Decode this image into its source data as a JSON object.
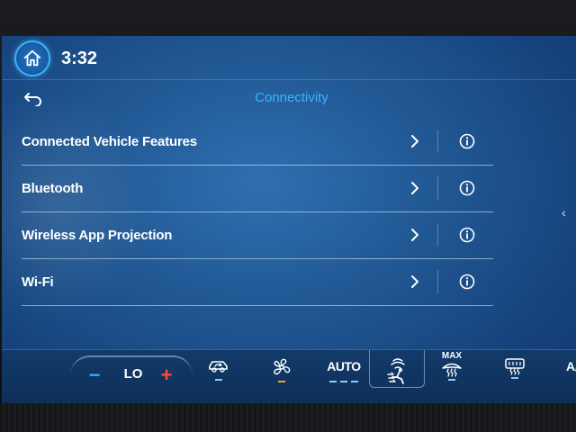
{
  "status_bar": {
    "time": "3:32",
    "home_icon": "home-icon"
  },
  "header": {
    "back_icon": "back-arrow-icon",
    "title": "Connectivity"
  },
  "settings_list": {
    "items": [
      {
        "label": "Connected Vehicle Features",
        "chevron_icon": "chevron-right-icon",
        "info_icon": "info-icon"
      },
      {
        "label": "Bluetooth",
        "chevron_icon": "chevron-right-icon",
        "info_icon": "info-icon"
      },
      {
        "label": "Wireless App Projection",
        "chevron_icon": "chevron-right-icon",
        "info_icon": "info-icon"
      },
      {
        "label": "Wi-Fi",
        "chevron_icon": "chevron-right-icon",
        "info_icon": "info-icon"
      }
    ]
  },
  "side_panel_tab": {
    "glyph": "‹"
  },
  "climate": {
    "temp_minus": "−",
    "temperature": "LO",
    "temp_plus": "+",
    "recirculation_icon": "recirculate-icon",
    "fan_icon": "fan-icon",
    "auto_label": "AUTO",
    "airflow_icon": "airflow-mode-icon",
    "max_defrost_label": "MAX",
    "max_defrost_icon": "max-defrost-icon",
    "rear_defrost_icon": "rear-defrost-icon",
    "ac_label": "A/C"
  },
  "colors": {
    "accent": "#3ab4ff",
    "screen_background": "#1f5590",
    "temp_minus": "#39a8ff",
    "temp_plus": "#ff4a3d",
    "fan_indicator": "#f0a030"
  }
}
